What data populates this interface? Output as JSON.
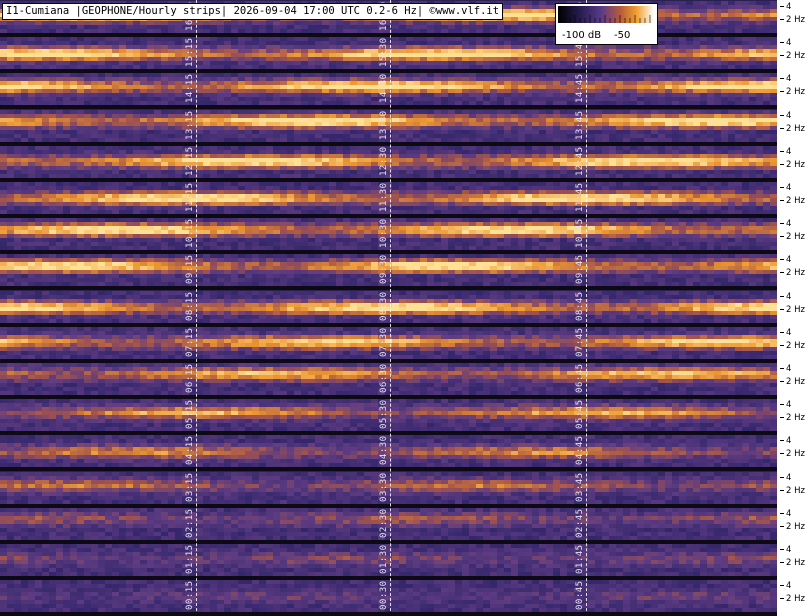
{
  "title": "I1-Cumiana |GEOPHONE/Hourly strips| 2026-09-04 17:00 UTC 0.2-6 Hz| ©www.vlf.it",
  "legend": {
    "min_label": "-100 dB",
    "max_label": "-50",
    "colormap": [
      "#000000",
      "#2b1f55",
      "#5a3a8a",
      "#b85a3c",
      "#f0a030",
      "#ffffff"
    ]
  },
  "y_axis": {
    "upper_tick": "4",
    "lower_tick": "2 Hz"
  },
  "strips": [
    {
      "hour": 16,
      "labels": [
        "16:15",
        "16:30",
        "16:45"
      ]
    },
    {
      "hour": 15,
      "labels": [
        "15:15",
        "15:30",
        "15:45"
      ]
    },
    {
      "hour": 14,
      "labels": [
        "14:15",
        "14:30",
        "14:45"
      ]
    },
    {
      "hour": 13,
      "labels": [
        "13:15",
        "13:30",
        "13:45"
      ]
    },
    {
      "hour": 12,
      "labels": [
        "12:15",
        "12:30",
        "12:45"
      ]
    },
    {
      "hour": 11,
      "labels": [
        "11:15",
        "11:30",
        "11:45"
      ]
    },
    {
      "hour": 10,
      "labels": [
        "10:15",
        "10:30",
        "10:45"
      ]
    },
    {
      "hour": 9,
      "labels": [
        "09:15",
        "09:30",
        "09:45"
      ]
    },
    {
      "hour": 8,
      "labels": [
        "08:15",
        "08:30",
        "08:45"
      ]
    },
    {
      "hour": 7,
      "labels": [
        "07:15",
        "07:30",
        "07:45"
      ]
    },
    {
      "hour": 6,
      "labels": [
        "06:15",
        "06:30",
        "06:45"
      ]
    },
    {
      "hour": 5,
      "labels": [
        "05:15",
        "05:30",
        "05:45"
      ]
    },
    {
      "hour": 4,
      "labels": [
        "04:15",
        "04:30",
        "04:45"
      ]
    },
    {
      "hour": 3,
      "labels": [
        "03:15",
        "03:30",
        "03:45"
      ]
    },
    {
      "hour": 2,
      "labels": [
        "02:15",
        "02:30",
        "02:45"
      ]
    },
    {
      "hour": 1,
      "labels": [
        "01:15",
        "01:30",
        "01:45"
      ]
    },
    {
      "hour": 0,
      "labels": [
        "00:15",
        "00:30",
        "00:45"
      ]
    }
  ]
}
